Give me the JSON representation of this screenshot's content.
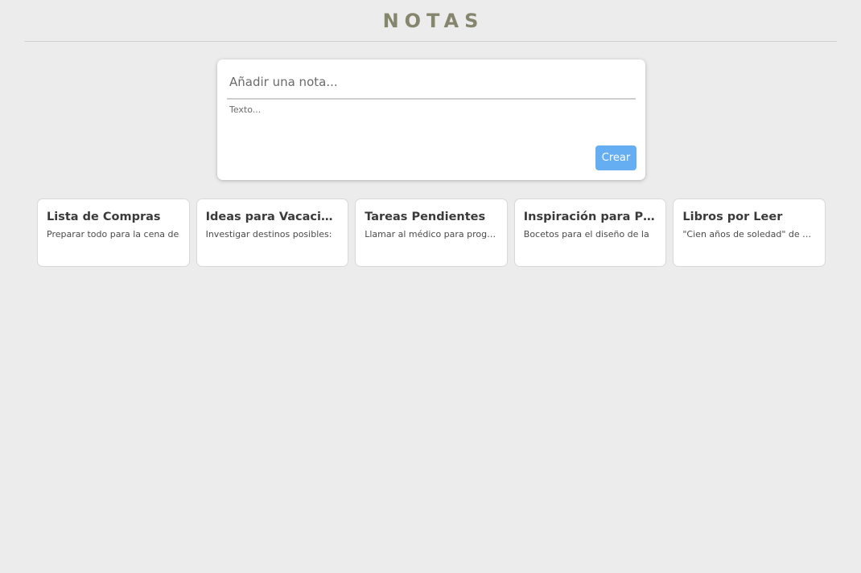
{
  "header": {
    "title": "NOTAS"
  },
  "composer": {
    "title_placeholder": "Añadir una nota...",
    "title_value": "",
    "body_placeholder": "Texto...",
    "body_value": "",
    "create_label": "Crear"
  },
  "notes": [
    {
      "title": "Lista de Compras",
      "body": "Preparar todo para la cena de"
    },
    {
      "title": "Ideas para Vacaciones",
      "body": "Investigar destinos posibles: "
    },
    {
      "title": "Tareas Pendientes",
      "body": "Llamar al médico para programar"
    },
    {
      "title": "Inspiración para Proyectos",
      "body": "Bocetos para el diseño de la "
    },
    {
      "title": "Libros por Leer",
      "body": "\"Cien años de soledad\" de Gabriel"
    }
  ],
  "colors": {
    "background": "#ececec",
    "title_color": "#86866e",
    "accent": "#66aef2",
    "card": "#ffffff"
  }
}
